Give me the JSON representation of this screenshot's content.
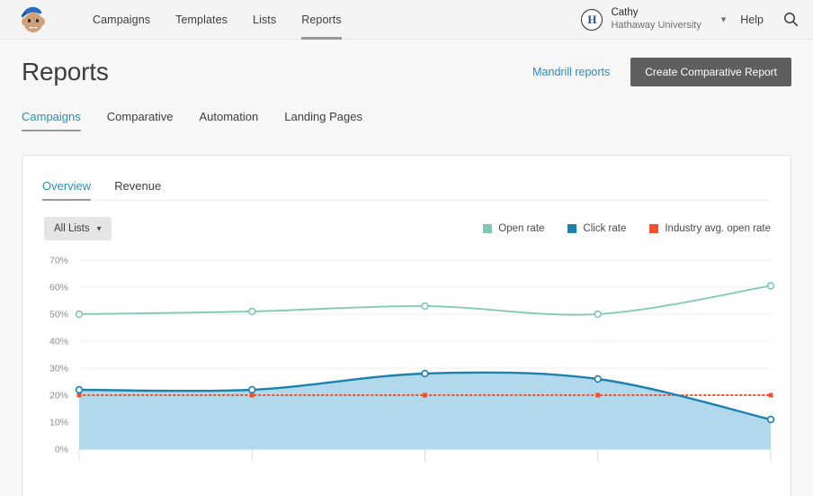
{
  "topnav": {
    "logo_icon": "mailchimp-freddie-logo",
    "links": [
      {
        "label": "Campaigns",
        "active": false
      },
      {
        "label": "Templates",
        "active": false
      },
      {
        "label": "Lists",
        "active": false
      },
      {
        "label": "Reports",
        "active": true
      }
    ],
    "account": {
      "avatar_initial": "H",
      "name": "Cathy",
      "org": "Hathaway University",
      "chevron_icon": "chevron-down-icon"
    },
    "help_label": "Help",
    "search_icon": "search-icon"
  },
  "header": {
    "title": "Reports",
    "mandrill_link": "Mandrill reports",
    "create_button": "Create Comparative Report"
  },
  "main_tabs": [
    {
      "label": "Campaigns",
      "active": true
    },
    {
      "label": "Comparative",
      "active": false
    },
    {
      "label": "Automation",
      "active": false
    },
    {
      "label": "Landing Pages",
      "active": false
    }
  ],
  "card": {
    "tabs": [
      {
        "label": "Overview",
        "active": true
      },
      {
        "label": "Revenue",
        "active": false
      }
    ],
    "lists_filter": {
      "label": "All Lists",
      "chevron_icon": "chevron-down-icon"
    }
  },
  "colors": {
    "open_rate": "#7ec8b6",
    "click_rate": "#1a82ad",
    "click_fill": "#aed6ea",
    "industry": "#f0502a",
    "accent_link": "#2a8fb5",
    "grid": "#ededed",
    "axis_text": "#8c8c8c"
  },
  "chart_data": {
    "type": "line",
    "title": "",
    "xlabel": "",
    "ylabel": "",
    "ylim": [
      0,
      70
    ],
    "yticks": [
      "0%",
      "10%",
      "20%",
      "30%",
      "40%",
      "50%",
      "60%",
      "70%"
    ],
    "ytick_values": [
      0,
      10,
      20,
      30,
      40,
      50,
      60,
      70
    ],
    "grid": true,
    "legend_position": "top-right",
    "x": [
      1,
      2,
      3,
      4,
      5
    ],
    "xticklabels": [
      "",
      "",
      "",
      "",
      ""
    ],
    "series": [
      {
        "name": "Open rate",
        "color": "#7ec8b6",
        "type": "line",
        "values": [
          50,
          51,
          53,
          50,
          60.5
        ]
      },
      {
        "name": "Click rate",
        "color": "#1a82ad",
        "type": "area",
        "fill": "#aed6ea",
        "values": [
          22,
          22,
          28,
          26,
          11
        ]
      },
      {
        "name": "Industry avg. open rate",
        "color": "#f0502a",
        "type": "dotted-line",
        "values": [
          20,
          20,
          20,
          20,
          20
        ]
      }
    ]
  }
}
